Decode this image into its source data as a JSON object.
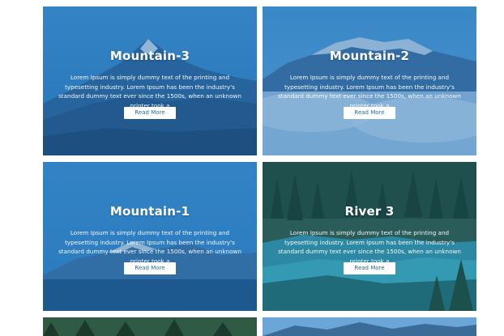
{
  "cards": [
    {
      "title": "Mountain-3",
      "text": "Lorem Ipsum is simply dummy text of the printing and typesetting industry. Lorem Ipsum has been the industry's standard dummy text ever since the 1500s, when an unknown printer took a",
      "button": "Read More"
    },
    {
      "title": "Mountain-2",
      "text": "Lorem Ipsum is simply dummy text of the printing and typesetting industry. Lorem Ipsum has been the industry's standard dummy text ever since the 1500s, when an unknown printer took a",
      "button": "Read More"
    },
    {
      "title": "Mountain-1",
      "text": "Lorem Ipsum is simply dummy text of the printing and typesetting industry. Lorem Ipsum has been the industry's standard dummy text ever since the 1500s, when an unknown printer took a",
      "button": "Read More"
    },
    {
      "title": "River 3",
      "text": "Lorem Ipsum is simply dummy text of the printing and typesetting industry. Lorem Ipsum has been the industry's standard dummy text ever since the 1500s, when an unknown printer took a",
      "button": "Read More"
    }
  ],
  "colors": {
    "blue_overlay": "#1f6fb3",
    "button_text": "#1f6fb3"
  }
}
